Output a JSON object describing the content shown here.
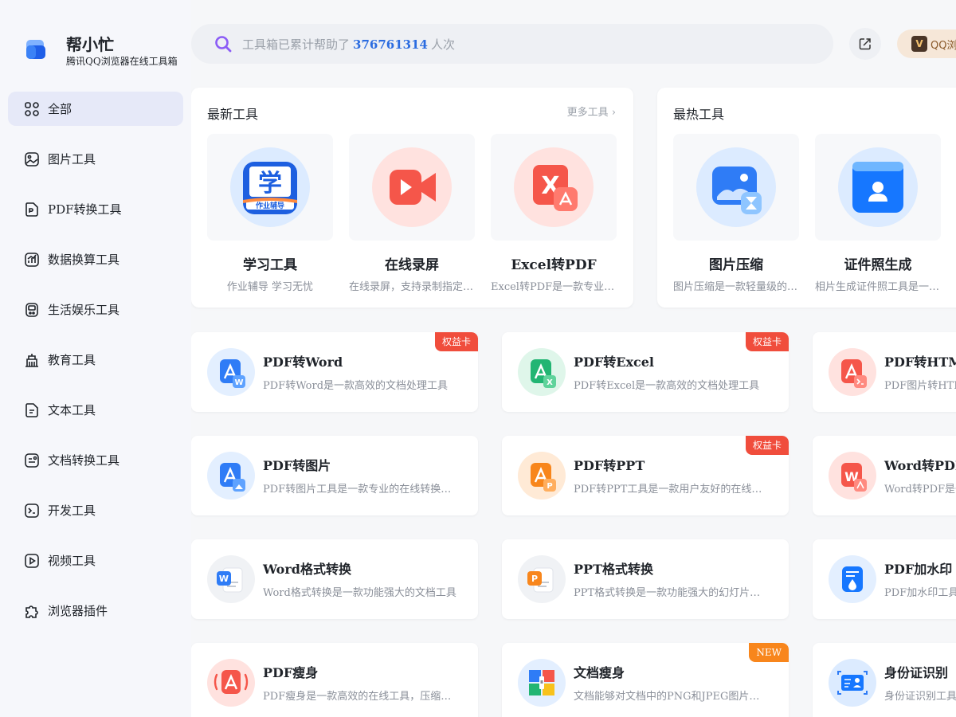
{
  "brand": {
    "title": "帮小忙",
    "subtitle": "腾讯QQ浏览器在线工具箱"
  },
  "nav": [
    {
      "label": "全部",
      "icon": "grid-icon",
      "active": true
    },
    {
      "label": "图片工具",
      "icon": "image-icon"
    },
    {
      "label": "PDF转换工具",
      "icon": "pdf-file-icon"
    },
    {
      "label": "数据换算工具",
      "icon": "chart-icon"
    },
    {
      "label": "生活娱乐工具",
      "icon": "gamepad-icon"
    },
    {
      "label": "教育工具",
      "icon": "school-icon"
    },
    {
      "label": "文本工具",
      "icon": "text-file-icon"
    },
    {
      "label": "文档转换工具",
      "icon": "doc-convert-icon"
    },
    {
      "label": "开发工具",
      "icon": "terminal-icon"
    },
    {
      "label": "视频工具",
      "icon": "video-icon"
    },
    {
      "label": "浏览器插件",
      "icon": "puzzle-icon"
    }
  ],
  "search": {
    "prefix": "工具箱已累计帮助了",
    "count": "376761314",
    "suffix": "人次"
  },
  "header": {
    "qq_label": "QQ浏览器",
    "qq_badge": "V"
  },
  "latest": {
    "title": "最新工具",
    "more": "更多工具",
    "tools": [
      {
        "name": "学习工具",
        "desc": "作业辅导 学习无忧",
        "icon": "study-helper-icon"
      },
      {
        "name": "在线录屏",
        "desc": "在线录屏，支持录制指定区域",
        "icon": "screen-record-icon"
      },
      {
        "name": "Excel转PDF",
        "desc": "Excel转PDF是一款专业的转换工具",
        "icon": "excel-to-pdf-icon"
      }
    ]
  },
  "hottest": {
    "title": "最热工具",
    "tools": [
      {
        "name": "图片压缩",
        "desc": "图片压缩是一款轻量级的压缩工具",
        "icon": "image-compress-icon"
      },
      {
        "name": "证件照生成",
        "desc": "相片生成证件照工具是一款实用工具",
        "icon": "id-photo-icon"
      }
    ]
  },
  "cards": [
    {
      "title": "PDF转Word",
      "desc": "PDF转Word是一款高效的文档处理工具",
      "badge": "权益卡",
      "icon": "pdf-to-word-icon"
    },
    {
      "title": "PDF转Excel",
      "desc": "PDF转Excel是一款高效的文档处理工具",
      "badge": "权益卡",
      "icon": "pdf-to-excel-icon"
    },
    {
      "title": "PDF转HTML",
      "desc": "PDF图片转HTML",
      "badge": "",
      "icon": "pdf-to-html-icon"
    },
    {
      "title": "PDF转图片",
      "desc": "PDF转图片工具是一款专业的在线转换工具",
      "badge": "",
      "icon": "pdf-to-image-icon"
    },
    {
      "title": "PDF转PPT",
      "desc": "PDF转PPT工具是一款用户友好的在线工具",
      "badge": "权益卡",
      "icon": "pdf-to-ppt-icon"
    },
    {
      "title": "Word转PDF",
      "desc": "Word转PDF是一",
      "badge": "",
      "icon": "word-to-pdf-icon"
    },
    {
      "title": "Word格式转换",
      "desc": "Word格式转换是一款功能强大的文档工具",
      "badge": "",
      "icon": "word-format-icon"
    },
    {
      "title": "PPT格式转换",
      "desc": "PPT格式转换是一款功能强大的幻灯片工具",
      "badge": "",
      "icon": "ppt-format-icon"
    },
    {
      "title": "PDF加水印",
      "desc": "PDF加水印工具",
      "badge": "",
      "icon": "pdf-watermark-icon"
    },
    {
      "title": "PDF瘦身",
      "desc": "PDF瘦身是一款高效的在线工具，压缩文件",
      "badge": "",
      "icon": "pdf-compress-icon"
    },
    {
      "title": "文档瘦身",
      "desc": "文档能够对文档中的PNG和JPEG图片进行压缩",
      "badge": "NEW",
      "icon": "doc-compress-icon"
    },
    {
      "title": "身份证识别",
      "desc": "身份证识别工具",
      "badge": "",
      "icon": "id-card-ocr-icon"
    }
  ],
  "colors": {
    "accent": "#2b6ce0",
    "badge_red": "#f04d3c",
    "badge_new": "#f8861c"
  }
}
